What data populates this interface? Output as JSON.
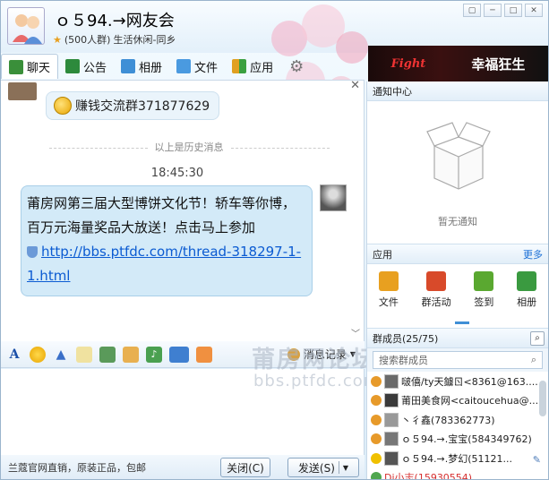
{
  "header": {
    "title": "ｏ５94.→网友会",
    "member_count": "(500人群)",
    "category": "生活休闲-同乡"
  },
  "toolbar": {
    "tabs": [
      {
        "label": "聊天",
        "icon": "chat-icon",
        "color": "#3a8f3a"
      },
      {
        "label": "公告",
        "icon": "megaphone-icon",
        "color": "#2d8a3c"
      },
      {
        "label": "相册",
        "icon": "photo-icon",
        "color": "#3f8fd6"
      },
      {
        "label": "文件",
        "icon": "folder-icon",
        "color": "#4a9ae0"
      },
      {
        "label": "应用",
        "icon": "apps-icon",
        "color": "#e0a020"
      }
    ]
  },
  "banner": {
    "text": "幸福狂生",
    "logo": "Fight"
  },
  "chat": {
    "history_message": "赚钱交流群371877629",
    "history_divider": "以上是历史消息",
    "time": "18:45:30",
    "message_text": "莆房网第三届大型博饼文化节！轿车等你博，百万元海量奖品大放送！点击马上参加",
    "message_link": "http://bbs.ptfdc.com/thread-318297-1-1.html"
  },
  "format_toolbar": {
    "records_label": "消息记录"
  },
  "watermark": {
    "line1": "莆房网论坛",
    "line2": "bbs.ptfdc.com"
  },
  "bottom": {
    "promo": "兰蔻官网直销，原装正品，包邮",
    "close_label": "关闭(C)",
    "send_label": "发送(S)"
  },
  "notice": {
    "title": "通知中心",
    "empty_text": "暂无通知"
  },
  "apps": {
    "title": "应用",
    "more": "更多",
    "items": [
      {
        "label": "文件",
        "color": "#e8a020"
      },
      {
        "label": "群活动",
        "color": "#d84a2a"
      },
      {
        "label": "签到",
        "color": "#5aa830"
      },
      {
        "label": "相册",
        "color": "#3a9a40"
      }
    ]
  },
  "members": {
    "title": "群成员(25/75)",
    "search_placeholder": "搜索群成员",
    "list": [
      {
        "name": "啵僖/ty天鐪ㄖ<8361@163....",
        "role_color": "#e79a2a",
        "avatar_color": "#6a6a6a"
      },
      {
        "name": "莆田美食网<caitoucehua@...",
        "role_color": "#e79a2a",
        "avatar_color": "#3a3a3a"
      },
      {
        "name": "丶彳鑫(783362773)",
        "role_color": "#e79a2a",
        "avatar_color": "#999999"
      },
      {
        "name": "ｏ５94.→.宝宝(584349762)",
        "role_color": "#e79a2a",
        "avatar_color": "#777777"
      },
      {
        "name": "ｏ５94.→.梦幻(51121...",
        "role_color": "#f0c000",
        "avatar_color": "#555555"
      },
      {
        "name": "Dj小志(15930554)",
        "role_color": "#4fa64f",
        "avatar_color": "#4fa64f",
        "highlight": "#d63030"
      }
    ]
  }
}
